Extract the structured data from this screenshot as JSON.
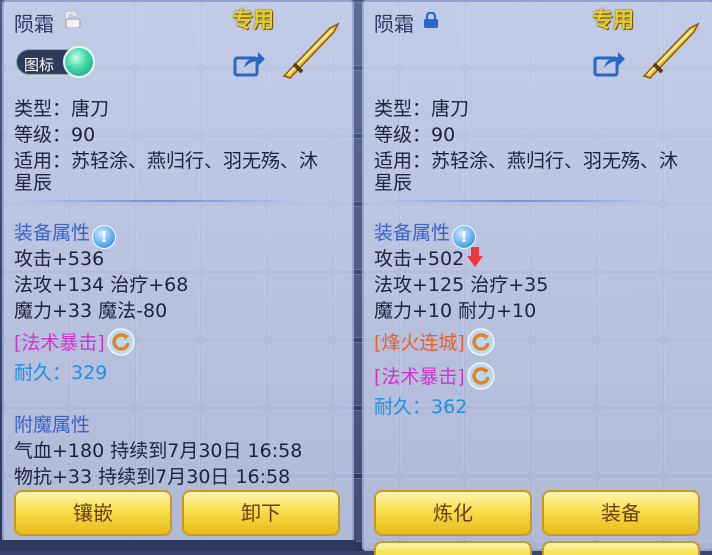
{
  "left_panel": {
    "name": "陨霜",
    "tag": "专用",
    "toggle_label": "图标",
    "type": "类型：唐刀",
    "level": "等级：90",
    "applies_line1": "适用：苏轻涂、燕归行、羽无殇、沐",
    "applies_line2": "星辰",
    "attr_heading": "装备属性",
    "attack": "攻击+536",
    "magic_heal": "法攻+134 治疗+68",
    "mana_line": "魔力+33 魔法-80",
    "special": "[法术暴击]",
    "durability_label": "耐久：",
    "durability_value": "329",
    "enchant_heading": "附魔属性",
    "enchant1": "气血+180 持续到7月30日 16:58",
    "enchant2": "物抗+33 持续到7月30日 16:58",
    "button1": "镶嵌",
    "button2": "卸下"
  },
  "right_panel": {
    "name": "陨霜",
    "tag": "专用",
    "type": "类型：唐刀",
    "level": "等级：90",
    "applies_line1": "适用：苏轻涂、燕归行、羽无殇、沐",
    "applies_line2": "星辰",
    "attr_heading": "装备属性",
    "attack": "攻击+502",
    "magic_heal": "法攻+125 治疗+35",
    "mana_line": "魔力+10 耐力+10",
    "special1": "[烽火连城]",
    "special2": "[法术暴击]",
    "durability_label": "耐久：",
    "durability_value": "362",
    "button1": "炼化",
    "button2": "装备"
  },
  "icons": {
    "lock_open": "lock-open-icon",
    "lock_closed": "lock-closed-icon",
    "share": "share-icon",
    "weapon": "tang-blade-icon",
    "info": "info-icon",
    "refresh": "refresh-icon",
    "down_arrow": "down-arrow-icon"
  },
  "colors": {
    "tag": "#e8d020",
    "heading": "#3a62c8",
    "durability": "#1f8fe6",
    "special_magenta": "#d034d0",
    "special_orange": "#e8602a",
    "button": "#f8de4a"
  }
}
